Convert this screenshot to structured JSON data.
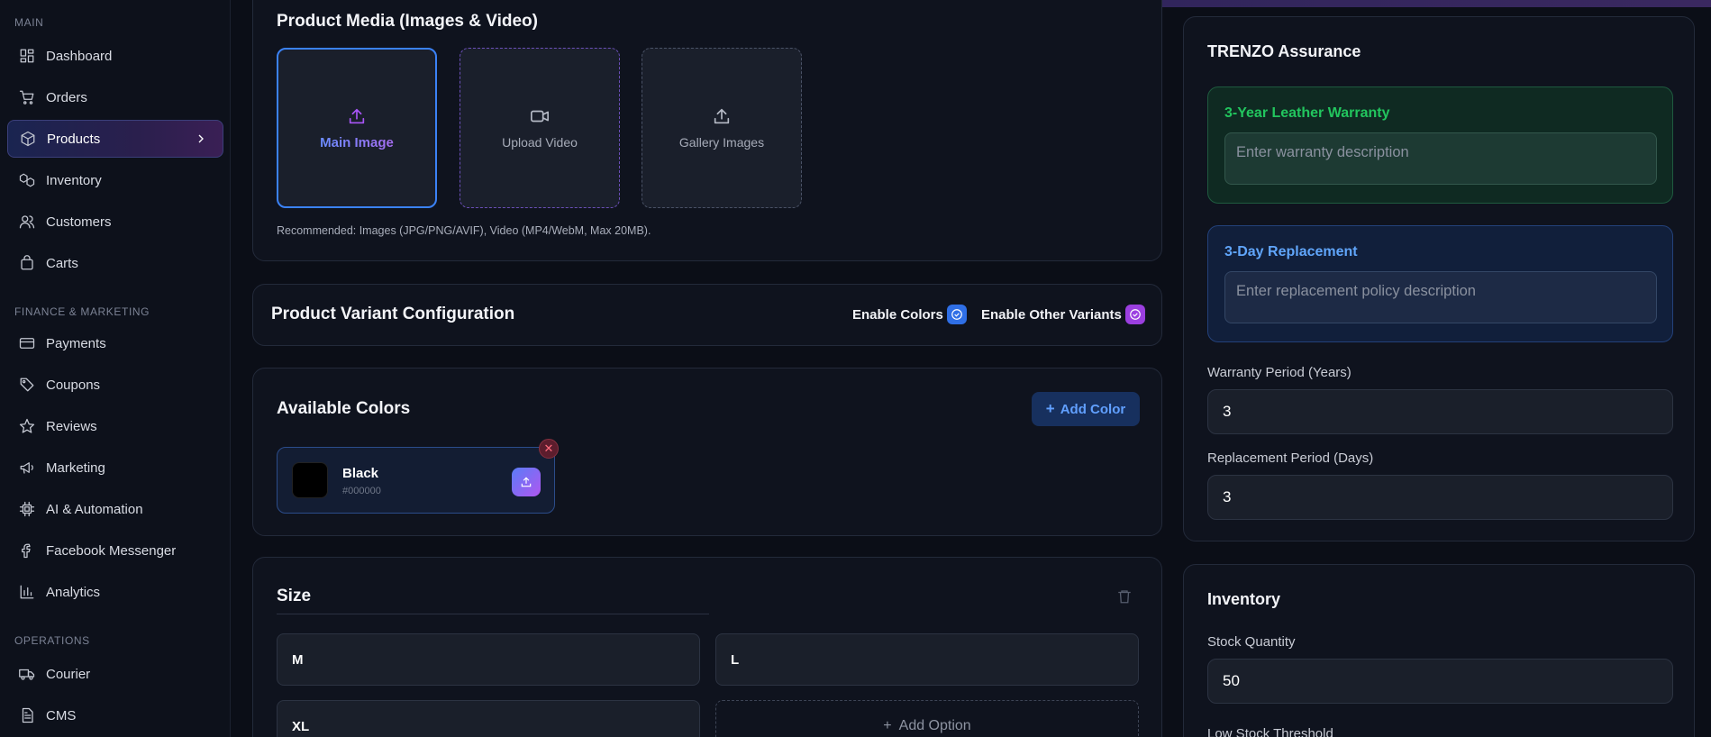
{
  "sidebar": {
    "sections": [
      {
        "title": "MAIN"
      },
      {
        "title": "FINANCE & MARKETING"
      },
      {
        "title": "OPERATIONS"
      }
    ],
    "items": [
      {
        "label": "Dashboard",
        "icon": "dashboard-icon"
      },
      {
        "label": "Orders",
        "icon": "cart-icon"
      },
      {
        "label": "Products",
        "icon": "box-icon",
        "active": true
      },
      {
        "label": "Inventory",
        "icon": "boxes-icon"
      },
      {
        "label": "Customers",
        "icon": "users-icon"
      },
      {
        "label": "Carts",
        "icon": "shopping-bag-icon"
      },
      {
        "label": "Payments",
        "icon": "credit-card-icon"
      },
      {
        "label": "Coupons",
        "icon": "tag-icon"
      },
      {
        "label": "Reviews",
        "icon": "star-icon"
      },
      {
        "label": "Marketing",
        "icon": "megaphone-icon"
      },
      {
        "label": "AI & Automation",
        "icon": "cpu-icon"
      },
      {
        "label": "Facebook Messenger",
        "icon": "facebook-icon"
      },
      {
        "label": "Analytics",
        "icon": "bar-chart-icon"
      },
      {
        "label": "Courier",
        "icon": "truck-icon"
      },
      {
        "label": "CMS",
        "icon": "document-icon"
      }
    ]
  },
  "media": {
    "title": "Product Media (Images & Video)",
    "main_label": "Main Image",
    "video_label": "Upload Video",
    "gallery_label": "Gallery Images",
    "hint": "Recommended: Images (JPG/PNG/AVIF), Video (MP4/WebM, Max 20MB)."
  },
  "variant_config": {
    "title": "Product Variant Configuration",
    "enable_colors": "Enable Colors",
    "enable_other": "Enable Other Variants",
    "colors_enabled": true,
    "other_enabled": true
  },
  "colors": {
    "title": "Available Colors",
    "add_label": "Add Color",
    "items": [
      {
        "name": "Black",
        "hex": "#000000"
      }
    ]
  },
  "size": {
    "title": "Size",
    "options": [
      "M",
      "L",
      "XL"
    ],
    "add_option_label": "Add Option"
  },
  "assurance": {
    "title": "TRENZO Assurance",
    "warranty_title": "3-Year Leather Warranty",
    "warranty_placeholder": "Enter warranty description",
    "replacement_title": "3-Day Replacement",
    "replacement_placeholder": "Enter replacement policy description",
    "warranty_period_label": "Warranty Period (Years)",
    "warranty_period_value": "3",
    "replacement_period_label": "Replacement Period (Days)",
    "replacement_period_value": "3"
  },
  "inventory": {
    "title": "Inventory",
    "stock_label": "Stock Quantity",
    "stock_value": "50",
    "low_stock_label": "Low Stock Threshold"
  },
  "colors_theme": {
    "accent_blue": "#3b82f6",
    "accent_purple": "#a855f7",
    "warranty_green": "#22c55e",
    "replacement_blue": "#60a5fa"
  }
}
